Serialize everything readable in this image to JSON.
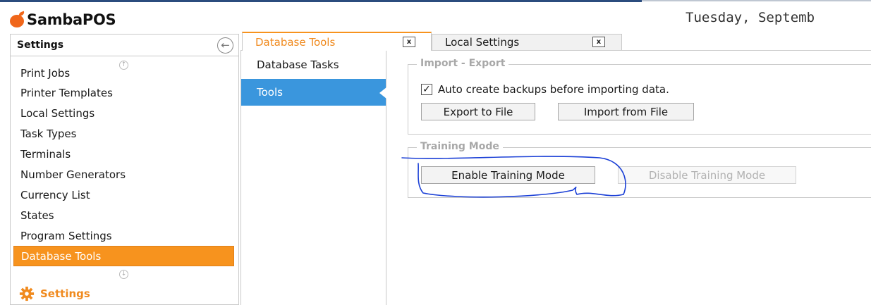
{
  "app": {
    "name": "SambaPOS",
    "datetime": "Tuesday, Septemb"
  },
  "colors": {
    "accent_orange": "#f7931e",
    "selected_blue": "#3a96dd",
    "annotation_blue": "#1a3fd6"
  },
  "sidebar": {
    "title": "Settings",
    "items": [
      {
        "label": "Print Jobs"
      },
      {
        "label": "Printer Templates"
      },
      {
        "label": "Local Settings"
      },
      {
        "label": "Task Types"
      },
      {
        "label": "Terminals"
      },
      {
        "label": "Number Generators"
      },
      {
        "label": "Currency List"
      },
      {
        "label": "States"
      },
      {
        "label": "Program Settings"
      },
      {
        "label": "Database Tools",
        "active": true
      }
    ],
    "footer_label": "Settings"
  },
  "tabs": [
    {
      "label": "Database Tools",
      "close": "x",
      "active": true
    },
    {
      "label": "Local Settings",
      "close": "x",
      "active": false
    }
  ],
  "inner_nav": [
    {
      "label": "Database Tasks",
      "active": false
    },
    {
      "label": "Tools",
      "active": true
    }
  ],
  "import_export": {
    "title": "Import - Export",
    "auto_backup_label": "Auto create backups before importing data.",
    "auto_backup_checked": true,
    "export_button": "Export to File",
    "import_button": "Import from File"
  },
  "training_mode": {
    "title": "Training Mode",
    "enable_button": "Enable Training Mode",
    "disable_button": "Disable Training Mode",
    "disable_enabled": false
  }
}
